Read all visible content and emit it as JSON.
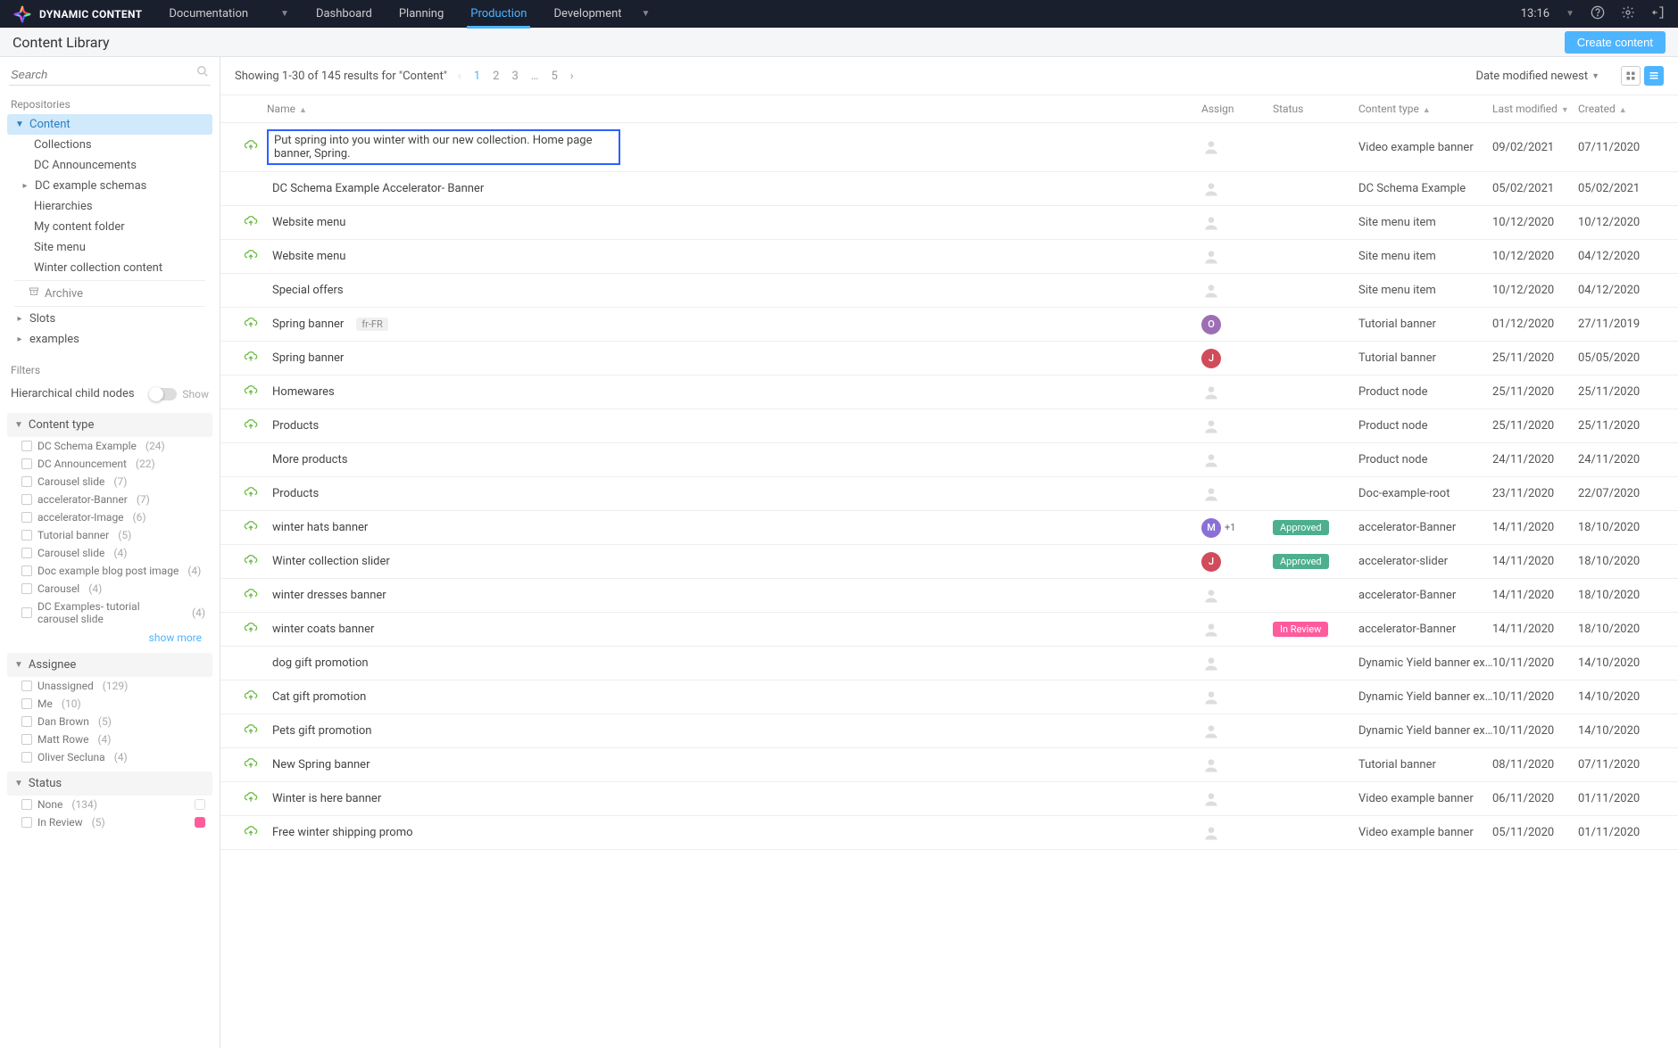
{
  "topbar": {
    "brand": "DYNAMIC CONTENT",
    "nav": {
      "doc": "Documentation",
      "dashboard": "Dashboard",
      "planning": "Planning",
      "production": "Production",
      "development": "Development"
    },
    "clock": "13:16"
  },
  "subheader": {
    "title": "Content Library",
    "create": "Create content"
  },
  "sidebar": {
    "search_placeholder": "Search",
    "repos_label": "Repositories",
    "repos": {
      "content": "Content",
      "children": {
        "collections": "Collections",
        "announce": "DC Announcements",
        "schemas": "DC example schemas",
        "hier": "Hierarchies",
        "mycf": "My content folder",
        "sitemenu": "Site menu",
        "winter": "Winter collection content"
      },
      "archive": "Archive",
      "slots": "Slots",
      "examples": "examples"
    },
    "filters_label": "Filters",
    "hierarchical_label": "Hierarchical child nodes",
    "toggle_show": "Show",
    "content_type_header": "Content type",
    "content_types": [
      {
        "label": "DC Schema Example",
        "count": "(24)"
      },
      {
        "label": "DC Announcement",
        "count": "(22)"
      },
      {
        "label": "Carousel slide",
        "count": "(7)"
      },
      {
        "label": "accelerator-Banner",
        "count": "(7)"
      },
      {
        "label": "accelerator-Image",
        "count": "(6)"
      },
      {
        "label": "Tutorial banner",
        "count": "(5)"
      },
      {
        "label": "Carousel slide",
        "count": "(4)"
      },
      {
        "label": "Doc example blog post image",
        "count": "(4)"
      },
      {
        "label": "Carousel",
        "count": "(4)"
      },
      {
        "label": "DC Examples- tutorial carousel slide",
        "count": "(4)"
      }
    ],
    "show_more": "show more",
    "assignee_header": "Assignee",
    "assignees": [
      {
        "label": "Unassigned",
        "count": "(129)"
      },
      {
        "label": "Me",
        "count": "(10)"
      },
      {
        "label": "Dan Brown",
        "count": "(5)"
      },
      {
        "label": "Matt Rowe",
        "count": "(4)"
      },
      {
        "label": "Oliver Secluna",
        "count": "(4)"
      }
    ],
    "status_header": "Status",
    "statuses": [
      {
        "label": "None",
        "count": "(134)"
      },
      {
        "label": "In Review",
        "count": "(5)"
      }
    ]
  },
  "main": {
    "results_text": "Showing 1-30 of 145 results for \"Content\"",
    "pages": [
      "1",
      "2",
      "3",
      "…",
      "5"
    ],
    "sort": "Date modified newest",
    "columns": {
      "name": "Name",
      "assign": "Assign",
      "status": "Status",
      "type": "Content type",
      "modified": "Last modified",
      "created": "Created"
    },
    "rows": [
      {
        "cloud": true,
        "name": "Put spring into you winter with our new collection. Home page banner, Spring.",
        "editing": true,
        "assign": "none",
        "status": "",
        "type": "Video example banner",
        "modified": "09/02/2021",
        "created": "07/11/2020"
      },
      {
        "cloud": false,
        "name": "DC Schema Example Accelerator- Banner",
        "assign": "none",
        "status": "",
        "type": "DC Schema Example",
        "modified": "05/02/2021",
        "created": "05/02/2021"
      },
      {
        "cloud": true,
        "name": "Website menu",
        "assign": "none",
        "status": "",
        "type": "Site menu item",
        "modified": "10/12/2020",
        "created": "10/12/2020"
      },
      {
        "cloud": true,
        "name": "Website menu",
        "assign": "none",
        "status": "",
        "type": "Site menu item",
        "modified": "10/12/2020",
        "created": "04/12/2020"
      },
      {
        "cloud": false,
        "name": "Special offers",
        "assign": "none",
        "status": "",
        "type": "Site menu item",
        "modified": "10/12/2020",
        "created": "04/12/2020"
      },
      {
        "cloud": true,
        "name": "Spring banner",
        "locale": "fr-FR",
        "assign": "O",
        "avatarColor": "purple",
        "status": "",
        "type": "Tutorial banner",
        "modified": "01/12/2020",
        "created": "27/11/2019"
      },
      {
        "cloud": true,
        "name": "Spring banner",
        "assign": "J",
        "avatarColor": "red",
        "status": "",
        "type": "Tutorial banner",
        "modified": "25/11/2020",
        "created": "05/05/2020"
      },
      {
        "cloud": true,
        "name": "Homewares",
        "assign": "none",
        "status": "",
        "type": "Product node",
        "modified": "25/11/2020",
        "created": "25/11/2020"
      },
      {
        "cloud": true,
        "name": "Products",
        "assign": "none",
        "status": "",
        "type": "Product node",
        "modified": "25/11/2020",
        "created": "25/11/2020"
      },
      {
        "cloud": false,
        "name": "More products",
        "assign": "none",
        "status": "",
        "type": "Product node",
        "modified": "24/11/2020",
        "created": "24/11/2020"
      },
      {
        "cloud": true,
        "name": "Products",
        "assign": "none",
        "status": "",
        "type": "Doc-example-root",
        "modified": "23/11/2020",
        "created": "22/07/2020"
      },
      {
        "cloud": true,
        "name": "winter hats banner",
        "assign": "M",
        "avatarColor": "violet",
        "plusMore": "+1",
        "status": "Approved",
        "statusClass": "approved",
        "type": "accelerator-Banner",
        "modified": "14/11/2020",
        "created": "18/10/2020"
      },
      {
        "cloud": true,
        "name": "Winter collection slider",
        "assign": "J",
        "avatarColor": "red",
        "status": "Approved",
        "statusClass": "approved",
        "type": "accelerator-slider",
        "modified": "14/11/2020",
        "created": "18/10/2020"
      },
      {
        "cloud": true,
        "name": "winter dresses banner",
        "assign": "none",
        "status": "",
        "type": "accelerator-Banner",
        "modified": "14/11/2020",
        "created": "18/10/2020"
      },
      {
        "cloud": true,
        "name": "winter coats banner",
        "assign": "none",
        "status": "In Review",
        "statusClass": "review",
        "type": "accelerator-Banner",
        "modified": "14/11/2020",
        "created": "18/10/2020"
      },
      {
        "cloud": false,
        "name": "dog gift promotion",
        "assign": "none",
        "status": "",
        "type": "Dynamic Yield banner ex…",
        "archived": true,
        "modified": "10/11/2020",
        "created": "14/10/2020"
      },
      {
        "cloud": true,
        "name": "Cat gift promotion",
        "assign": "none",
        "status": "",
        "type": "Dynamic Yield banner ex…",
        "archived": true,
        "modified": "10/11/2020",
        "created": "14/10/2020"
      },
      {
        "cloud": true,
        "name": "Pets gift promotion",
        "assign": "none",
        "status": "",
        "type": "Dynamic Yield banner ex…",
        "archived": true,
        "modified": "10/11/2020",
        "created": "14/10/2020"
      },
      {
        "cloud": true,
        "name": "New Spring banner",
        "assign": "none",
        "status": "",
        "type": "Tutorial banner",
        "modified": "08/11/2020",
        "created": "07/11/2020"
      },
      {
        "cloud": true,
        "name": "Winter is here banner",
        "assign": "none",
        "status": "",
        "type": "Video example banner",
        "modified": "06/11/2020",
        "created": "01/11/2020"
      },
      {
        "cloud": true,
        "name": "Free winter shipping promo",
        "assign": "none",
        "status": "",
        "type": "Video example banner",
        "modified": "05/11/2020",
        "created": "01/11/2020"
      }
    ]
  }
}
